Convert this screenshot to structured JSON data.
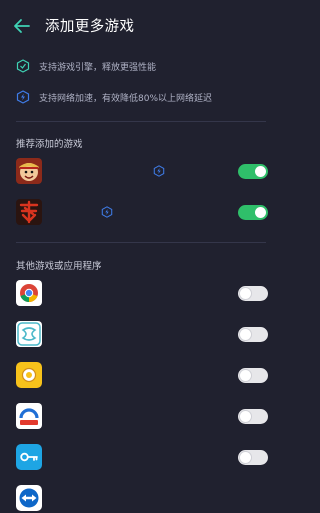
{
  "header": {
    "title": "添加更多游戏"
  },
  "features": [
    {
      "icon": "engine-icon",
      "text": "支持游戏引擎，释放更强性能"
    },
    {
      "icon": "network-boost-icon",
      "text": "支持网络加速，有效降低80%以上网络延迟"
    }
  ],
  "recommended": {
    "title": "推荐添加的游戏",
    "items": [
      {
        "icon": "one-piece-game-icon",
        "badge": "network-boost-icon",
        "enabled": true
      },
      {
        "icon": "sha-game-icon",
        "badge": "network-boost-icon",
        "enabled": true
      }
    ]
  },
  "others": {
    "title": "其他游戏或应用程序",
    "items": [
      {
        "icon": "chrome-icon",
        "enabled": false
      },
      {
        "icon": "tiled-app-icon",
        "enabled": false
      },
      {
        "icon": "yellow-app-icon",
        "enabled": false
      },
      {
        "icon": "blue-red-app-icon",
        "enabled": false
      },
      {
        "icon": "key-app-icon",
        "enabled": false
      },
      {
        "icon": "teamviewer-icon",
        "enabled": false
      }
    ]
  },
  "colors": {
    "background": "#20212f",
    "toggle_on": "#2fbf6a",
    "toggle_off": "#e7e7ea",
    "accent": "#3f7ce8"
  }
}
